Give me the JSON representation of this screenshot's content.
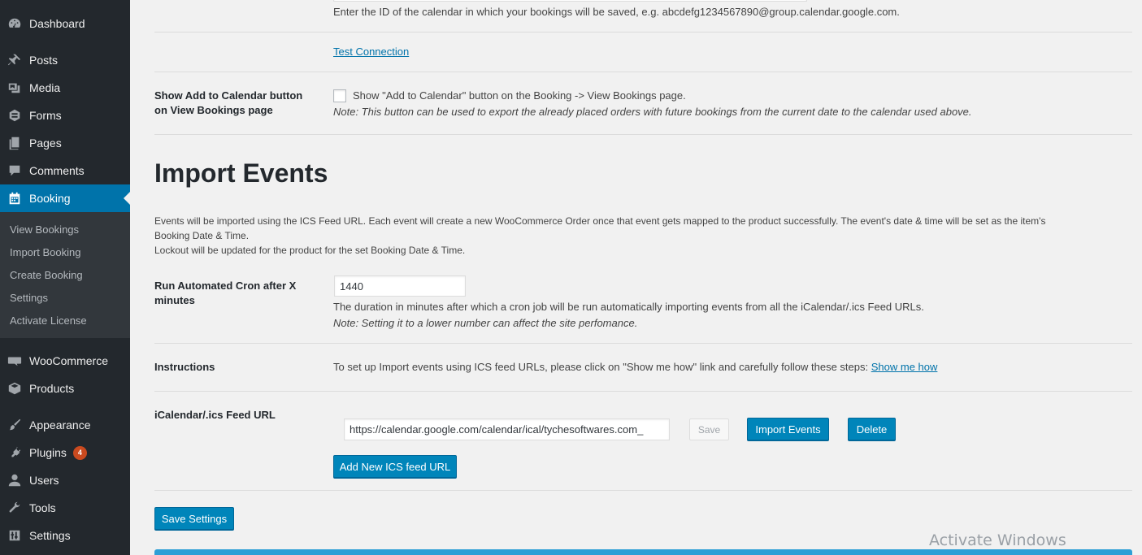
{
  "sidebar": {
    "items": [
      {
        "label": "Dashboard",
        "icon": "dashboard-icon"
      },
      {
        "label": "Posts",
        "icon": "pin-icon"
      },
      {
        "label": "Media",
        "icon": "media-icon"
      },
      {
        "label": "Forms",
        "icon": "forms-icon"
      },
      {
        "label": "Pages",
        "icon": "pages-icon"
      },
      {
        "label": "Comments",
        "icon": "comments-icon"
      },
      {
        "label": "Booking",
        "icon": "calendar-icon",
        "current": true
      },
      {
        "label": "WooCommerce",
        "icon": "woo-icon"
      },
      {
        "label": "Products",
        "icon": "box-icon"
      },
      {
        "label": "Appearance",
        "icon": "brush-icon"
      },
      {
        "label": "Plugins",
        "icon": "plug-icon",
        "badge": "4"
      },
      {
        "label": "Users",
        "icon": "user-icon"
      },
      {
        "label": "Tools",
        "icon": "wrench-icon"
      },
      {
        "label": "Settings",
        "icon": "sliders-icon"
      }
    ],
    "submenu": [
      "View Bookings",
      "Import Booking",
      "Create Booking",
      "Settings",
      "Activate License"
    ]
  },
  "calendar_id": {
    "desc": "Enter the ID of the calendar in which your bookings will be saved, e.g. abcdefg1234567890@group.calendar.google.com."
  },
  "test_connection": {
    "label": "Test Connection"
  },
  "add_to_calendar": {
    "label_line1": "Show Add to Calendar button",
    "label_line2": "on View Bookings page",
    "checkbox_text": "Show \"Add to Calendar\" button on the Booking -> View Bookings page.",
    "note": "Note: This button can be used to export the already placed orders with future bookings from the current date to the calendar used above.",
    "checked": false
  },
  "import_events": {
    "heading": "Import Events",
    "intro_line1": "Events will be imported using the ICS Feed URL. Each event will create a new WooCommerce Order once that event gets mapped to the product successfully. The event's date & time will be set as the item's",
    "intro_line2": "Booking Date & Time.",
    "intro_line3": "Lockout will be updated for the product for the set Booking Date & Time."
  },
  "cron": {
    "label_line1": "Run Automated Cron after X",
    "label_line2": "minutes",
    "value": "1440",
    "desc": "The duration in minutes after which a cron job will be run automatically importing events from all the iCalendar/.ics Feed URLs.",
    "note": "Note: Setting it to a lower number can affect the site perfomance."
  },
  "instructions": {
    "label": "Instructions",
    "text": "To set up Import events using ICS feed URLs, please click on \"Show me how\" link and carefully follow these steps:",
    "link": "Show me how"
  },
  "feed": {
    "label": "iCalendar/.ics Feed URL",
    "url": "https://calendar.google.com/calendar/ical/tychesoftwares.com_",
    "save_label": "Save",
    "import_label": "Import Events",
    "delete_label": "Delete",
    "add_new_label": "Add New ICS feed URL"
  },
  "save_settings_label": "Save Settings",
  "watermark": "Activate Windows",
  "colors": {
    "sidebar_bg": "#23282d",
    "submenu_bg": "#32373c",
    "accent": "#0073aa",
    "button": "#0085ba",
    "badge": "#ca4a1f"
  }
}
